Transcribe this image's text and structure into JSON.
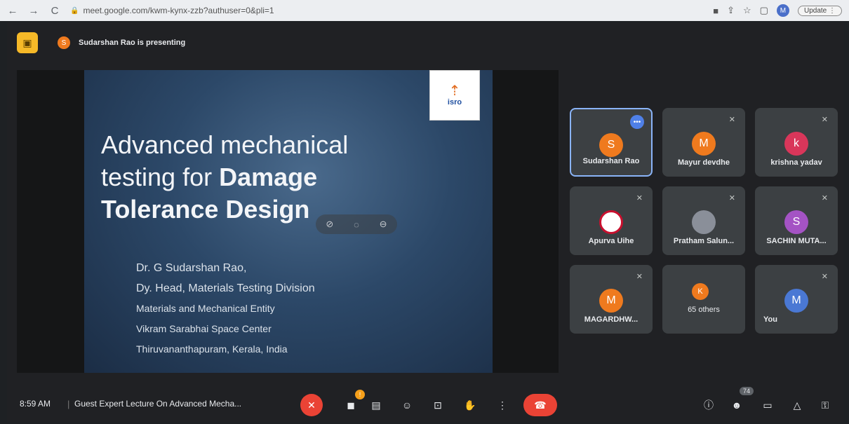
{
  "browser": {
    "url": "meet.google.com/kwm-kynx-zzb?authuser=0&pli=1",
    "profile_initial": "M",
    "update_label": "Update"
  },
  "presenter": {
    "avatar_initial": "S",
    "text": "Sudarshan Rao is presenting"
  },
  "slide": {
    "logo_text": "isro",
    "title_line1": "Advanced mechanical",
    "title_line2_normal": "testing for ",
    "title_line2_bold": "Damage",
    "title_line3_bold": "Tolerance Design",
    "info_line1": "Dr. G Sudarshan Rao,",
    "info_line2": "Dy. Head, Materials Testing Division",
    "info_line3": "Materials and Mechanical Entity",
    "info_line4": "Vikram Sarabhai Space Center",
    "info_line5": "Thiruvananthapuram, Kerala, India"
  },
  "participants": [
    {
      "name": "Sudarshan Rao",
      "initial": "S",
      "color": "#ef7a1e"
    },
    {
      "name": "Mayur devdhe",
      "initial": "M",
      "color": "#ef7a1e"
    },
    {
      "name": "krishna yadav",
      "initial": "k",
      "color": "#d9365a"
    },
    {
      "name": "Apurva Uihe",
      "initial": "",
      "color": "#ffffff"
    },
    {
      "name": "Pratham Salun...",
      "initial": "",
      "color": "#8a8f99"
    },
    {
      "name": "SACHIN MUTA...",
      "initial": "S",
      "color": "#a453c4"
    },
    {
      "name": "MAGARDHW...",
      "initial": "M",
      "color": "#ef7a1e"
    },
    {
      "name": "65 others",
      "initial": "K",
      "color": "#ef7a1e"
    },
    {
      "name": "You",
      "initial": "M",
      "color": "#4a78d4"
    }
  ],
  "bottom": {
    "time": "8:59 AM",
    "separator": "|",
    "meeting_title": "Guest Expert Lecture On Advanced Mecha...",
    "people_count": "74"
  }
}
